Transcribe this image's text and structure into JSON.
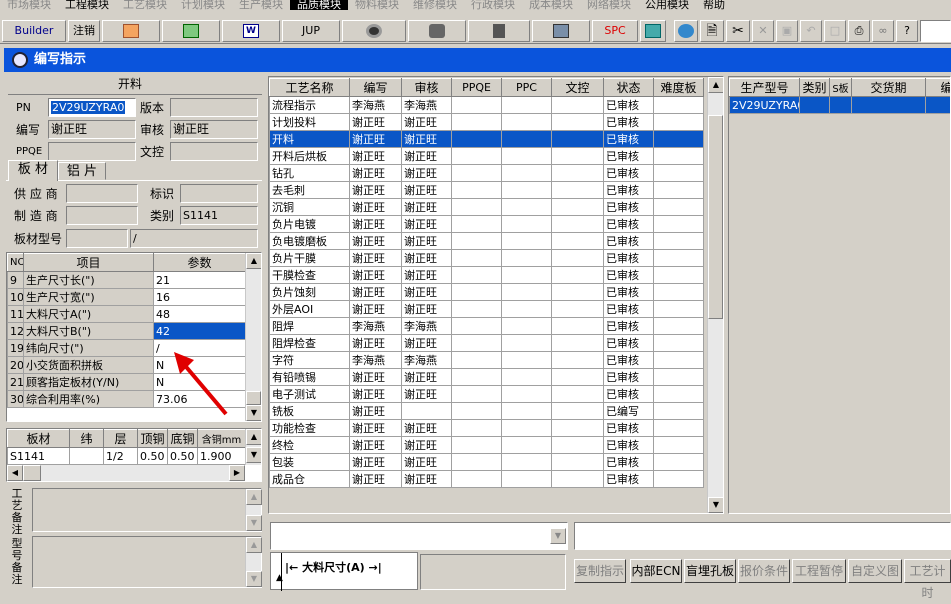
{
  "menu": {
    "items": [
      "市场模块",
      "工程模块",
      "工艺模块",
      "计划模块",
      "生产模块",
      "品质模块",
      "物料模块",
      "维修模块",
      "行政模块",
      "成本模块",
      "网络模块",
      "公用模块",
      "帮助"
    ],
    "active": "品质模块"
  },
  "toolbar": {
    "builder": "Builder",
    "logout": "注销",
    "jup": "JUP",
    "spc": "SPC"
  },
  "window": {
    "title": "编写指示"
  },
  "left": {
    "section": "开料",
    "pn_label": "PN",
    "pn_value": "2V29UZYRA0",
    "version_label": "版本",
    "version_value": "",
    "writer_label": "编写",
    "writer_value": "谢正旺",
    "reviewer_label": "审核",
    "reviewer_value": "谢正旺",
    "ppqe_label": "PPQE",
    "ppqe_value": "",
    "doc_label": "文控",
    "doc_value": "",
    "tabs": [
      "板 材",
      "铝 片"
    ],
    "supplier_label": "供 应 商",
    "supplier_value": "",
    "mark_label": "标识",
    "mark_value": "",
    "maker_label": "制 造 商",
    "maker_value": "",
    "type_label": "类别",
    "type_value": "S1141",
    "model_label": "板材型号",
    "model_value": "",
    "model_value2": "/",
    "param_headers": [
      "NO",
      "项目",
      "参数"
    ],
    "params": [
      {
        "no": "9",
        "item": "生产尺寸长(\")",
        "val": "21"
      },
      {
        "no": "10",
        "item": "生产尺寸宽(\")",
        "val": "16"
      },
      {
        "no": "11",
        "item": "大料尺寸A(\")",
        "val": "48"
      },
      {
        "no": "12",
        "item": "大料尺寸B(\")",
        "val": "42"
      },
      {
        "no": "19",
        "item": "纬向尺寸(\")",
        "val": "/"
      },
      {
        "no": "20",
        "item": "小交货面积拼板",
        "val": "N"
      },
      {
        "no": "21",
        "item": "顾客指定板材(Y/N)",
        "val": "N"
      },
      {
        "no": "30",
        "item": "综合利用率(%)",
        "val": "73.06"
      }
    ],
    "board_headers": [
      "板材",
      "纬",
      "层",
      "顶铜",
      "底铜",
      "含铜mm"
    ],
    "board_rows": [
      {
        "c1": "S1141",
        "c2": "",
        "c3": "1/2",
        "c4": "0.50",
        "c5": "0.50",
        "c6": "1.900"
      }
    ],
    "note1": "工艺备注",
    "note2": "型号备注"
  },
  "process": {
    "headers": [
      "工艺名称",
      "编写",
      "审核",
      "PPQE",
      "PPC",
      "文控",
      "状态",
      "难度板"
    ],
    "rows": [
      [
        "流程指示",
        "李海燕",
        "李海燕",
        "",
        "",
        "",
        "已审核",
        ""
      ],
      [
        "计划投料",
        "谢正旺",
        "谢正旺",
        "",
        "",
        "",
        "已审核",
        ""
      ],
      [
        "开料",
        "谢正旺",
        "谢正旺",
        "",
        "",
        "",
        "已审核",
        ""
      ],
      [
        "开料后烘板",
        "谢正旺",
        "谢正旺",
        "",
        "",
        "",
        "已审核",
        ""
      ],
      [
        "钻孔",
        "谢正旺",
        "谢正旺",
        "",
        "",
        "",
        "已审核",
        ""
      ],
      [
        "去毛刺",
        "谢正旺",
        "谢正旺",
        "",
        "",
        "",
        "已审核",
        ""
      ],
      [
        "沉铜",
        "谢正旺",
        "谢正旺",
        "",
        "",
        "",
        "已审核",
        ""
      ],
      [
        "负片电镀",
        "谢正旺",
        "谢正旺",
        "",
        "",
        "",
        "已审核",
        ""
      ],
      [
        "负电镀磨板",
        "谢正旺",
        "谢正旺",
        "",
        "",
        "",
        "已审核",
        ""
      ],
      [
        "负片干膜",
        "谢正旺",
        "谢正旺",
        "",
        "",
        "",
        "已审核",
        ""
      ],
      [
        "干膜检查",
        "谢正旺",
        "谢正旺",
        "",
        "",
        "",
        "已审核",
        ""
      ],
      [
        "负片蚀刻",
        "谢正旺",
        "谢正旺",
        "",
        "",
        "",
        "已审核",
        ""
      ],
      [
        "外层AOI",
        "谢正旺",
        "谢正旺",
        "",
        "",
        "",
        "已审核",
        ""
      ],
      [
        "阻焊",
        "李海燕",
        "李海燕",
        "",
        "",
        "",
        "已审核",
        ""
      ],
      [
        "阻焊检查",
        "谢正旺",
        "谢正旺",
        "",
        "",
        "",
        "已审核",
        ""
      ],
      [
        "字符",
        "李海燕",
        "李海燕",
        "",
        "",
        "",
        "已审核",
        ""
      ],
      [
        "有铅喷锡",
        "谢正旺",
        "谢正旺",
        "",
        "",
        "",
        "已审核",
        ""
      ],
      [
        "电子测试",
        "谢正旺",
        "谢正旺",
        "",
        "",
        "",
        "已审核",
        ""
      ],
      [
        "铣板",
        "谢正旺",
        "",
        "",
        "",
        "",
        "已编写",
        ""
      ],
      [
        "功能检查",
        "谢正旺",
        "谢正旺",
        "",
        "",
        "",
        "已审核",
        ""
      ],
      [
        "终检",
        "谢正旺",
        "谢正旺",
        "",
        "",
        "",
        "已审核",
        ""
      ],
      [
        "包装",
        "谢正旺",
        "谢正旺",
        "",
        "",
        "",
        "已审核",
        ""
      ],
      [
        "成品仓",
        "谢正旺",
        "谢正旺",
        "",
        "",
        "",
        "已审核",
        ""
      ]
    ],
    "selected_index": 2
  },
  "model": {
    "headers": [
      "生产型号",
      "类别",
      "S板",
      "交货期",
      "编写"
    ],
    "rows": [
      [
        "2V29UZYRA0",
        "",
        "",
        "",
        ""
      ]
    ]
  },
  "diagram": {
    "label": "大料尺寸(A)"
  },
  "buttons": [
    "复制指示",
    "内部ECN",
    "盲埋孔板",
    "报价条件",
    "工程暂停",
    "自定义图",
    "工艺计时"
  ]
}
